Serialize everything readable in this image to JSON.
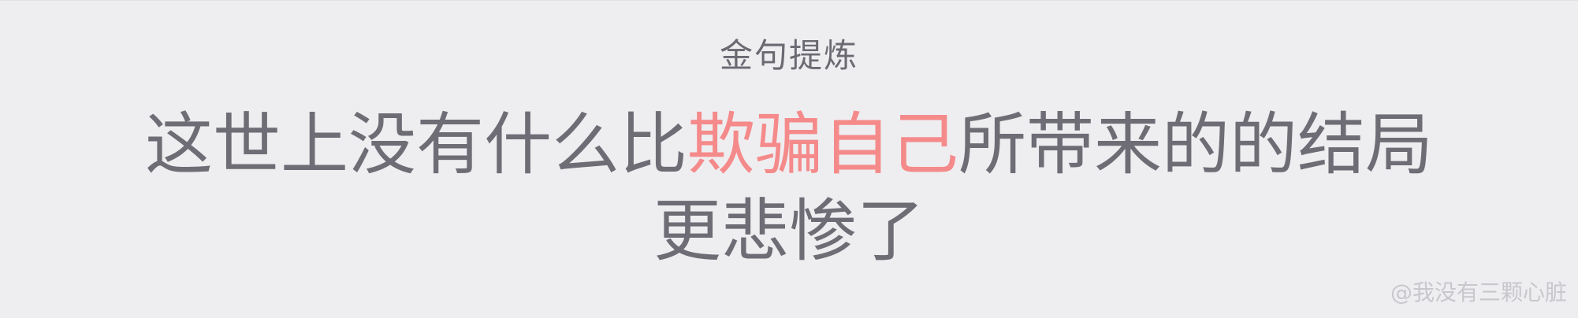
{
  "card": {
    "heading": "金句提炼",
    "quote": {
      "line1_before": "这世上没有什么比",
      "line1_highlight": "欺骗自己",
      "line1_after": "所带来的的结局",
      "line2": "更悲惨了"
    },
    "watermark": "@我没有三颗心脏"
  },
  "colors": {
    "background": "#eeeef1",
    "text": "#6e6d75",
    "highlight": "#f58a8a",
    "watermark": "#c8c7cc"
  }
}
